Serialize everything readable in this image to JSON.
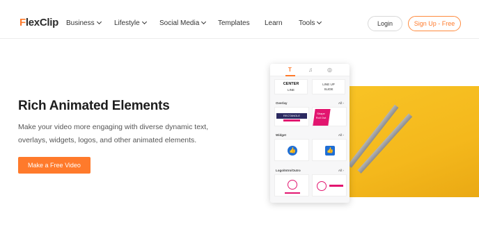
{
  "brand": {
    "logo_letter": "F",
    "logo_rest": "lexClip"
  },
  "nav": {
    "items": [
      {
        "label": "Business",
        "dropdown": true
      },
      {
        "label": "Lifestyle",
        "dropdown": true
      },
      {
        "label": "Social Media",
        "dropdown": true
      },
      {
        "label": "Templates",
        "dropdown": false
      },
      {
        "label": "Learn",
        "dropdown": false
      },
      {
        "label": "Tools",
        "dropdown": true
      }
    ],
    "login_label": "Login",
    "signup_label": "Sign Up - Free"
  },
  "hero": {
    "title": "Rich Animated Elements",
    "description": "Make your video more engaging with diverse dynamic text, overlays, widgets, logos, and other animated elements.",
    "cta_label": "Make a Free Video"
  },
  "panel": {
    "tabs": [
      {
        "icon": "text-icon",
        "glyph": "T",
        "active": true
      },
      {
        "icon": "music-icon",
        "glyph": "♫",
        "active": false
      },
      {
        "icon": "element-icon",
        "glyph": "◎",
        "active": false
      }
    ],
    "text_cards": [
      {
        "line1": "CENTER",
        "line2": "LINE"
      },
      {
        "line1": "LINE UP",
        "line2": "SLIDE"
      }
    ],
    "sections": [
      {
        "label": "Overlay",
        "all_label": "All ›"
      },
      {
        "label": "Widget",
        "all_label": "All ›"
      },
      {
        "label": "Logo/Intro/Outro",
        "all_label": "All ›"
      }
    ],
    "overlay_cards": [
      {
        "line1": "RECTANGLE",
        "line2": ""
      },
      {
        "line1": "Shape",
        "line2": "Roll Out"
      }
    ]
  },
  "colors": {
    "accent": "#ff7a2b",
    "yellow": "#f6bd21",
    "navy": "#2b2960",
    "pink": "#e2156f",
    "like_blue": "#1f6ed4"
  }
}
